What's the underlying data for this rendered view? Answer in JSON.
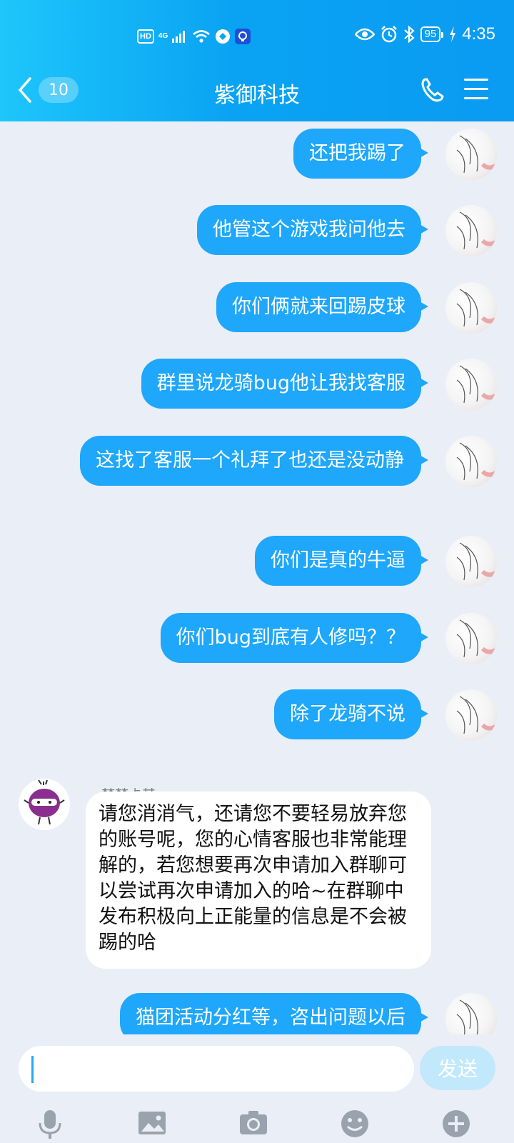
{
  "status_bar": {
    "hd": "HD",
    "network": "4G",
    "battery": "95",
    "time": "4:35"
  },
  "header": {
    "back_count": "10",
    "title": "紫御科技",
    "icons": [
      "back-chevron-icon",
      "phone-icon",
      "menu-icon"
    ]
  },
  "messages_out": [
    {
      "text": "还把我踢了"
    },
    {
      "text": "他管这个游戏我问他去"
    },
    {
      "text": "你们俩就来回踢皮球"
    },
    {
      "text": "群里说龙骑bug他让我找客服"
    },
    {
      "text": "这找了客服一个礼拜了也还是没动静"
    },
    {
      "text": "你们是真的牛逼"
    },
    {
      "text": "你们bug到底有人修吗？？"
    },
    {
      "text": "除了龙骑不说"
    }
  ],
  "incoming": {
    "sender": "梦梦卡其",
    "text": "请您消消气，还请您不要轻易放弃您的账号呢，您的心情客服也非常能理解的，若您想要再次申请加入群聊可以尝试再次申请加入的哈~在群聊中发布积极向上正能量的信息是不会被踢的哈"
  },
  "partial_message": {
    "text": "猫团活动分红等，咨出问题以后"
  },
  "input": {
    "value": "",
    "send_label": "发送"
  },
  "toolbar": [
    "microphone-icon",
    "image-icon",
    "camera-icon",
    "emoji-icon",
    "plus-icon"
  ],
  "colors": {
    "header_gradient_start": "#1ec6fb",
    "header_gradient_end": "#0a9bf2",
    "bubble_out": "#1ea7fb",
    "bubble_in": "#ffffff",
    "background": "#eaeef6",
    "send_disabled": "#c2e8fc"
  }
}
